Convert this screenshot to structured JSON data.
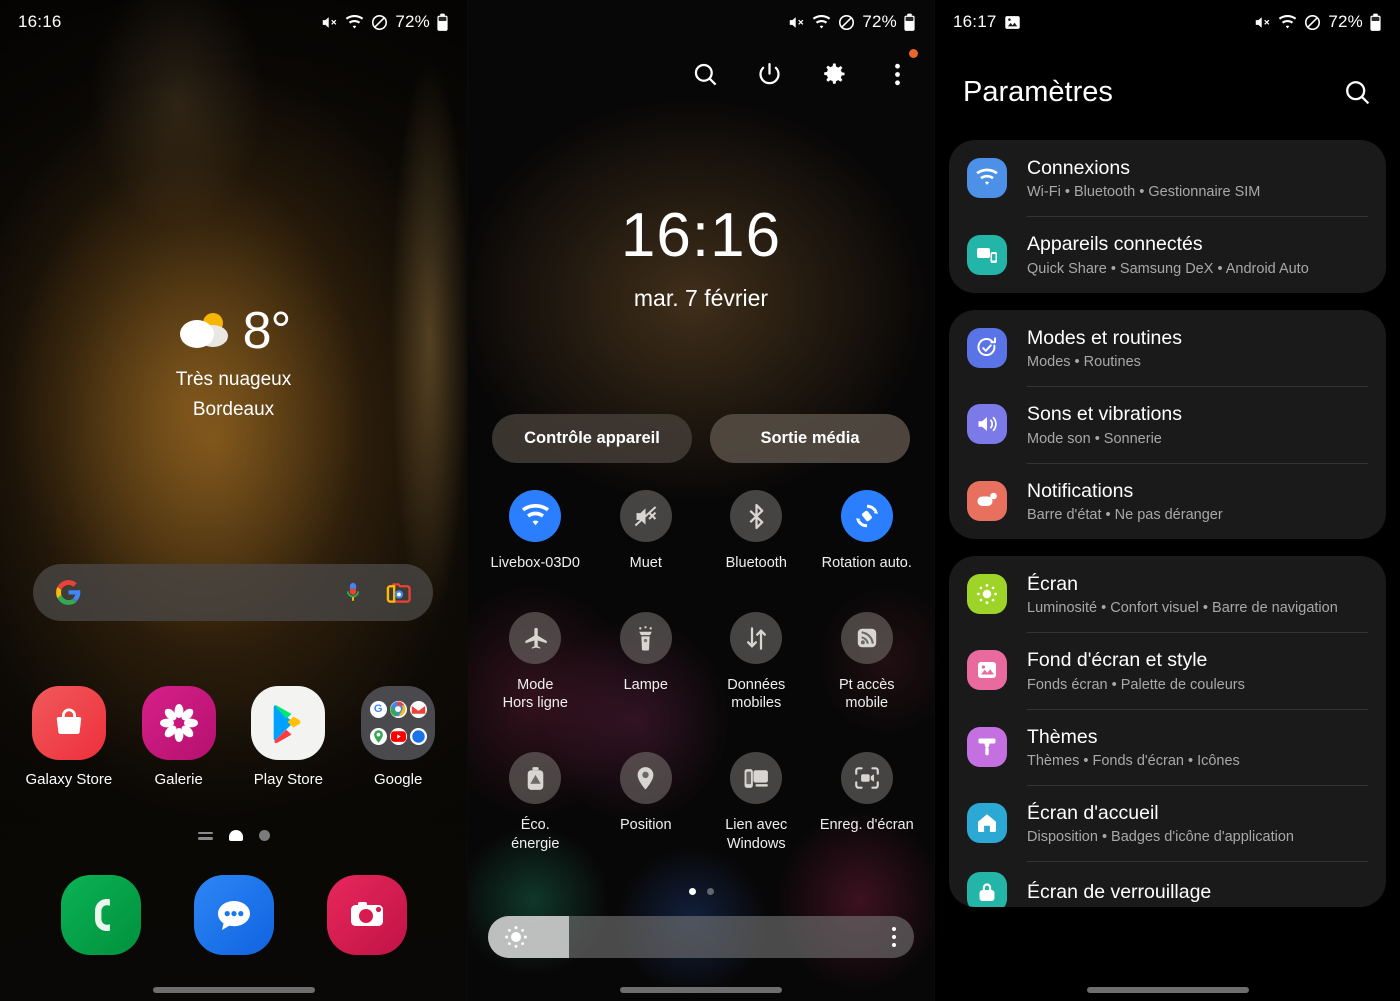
{
  "home": {
    "statusbar": {
      "time": "16:16",
      "battery_pct": "72%",
      "icons": [
        "mute-icon",
        "wifi-icon",
        "do-not-disturb-icon",
        "battery-icon"
      ]
    },
    "weather": {
      "icon": "partly-cloudy-icon",
      "temperature": "8°",
      "condition": "Très nuageux",
      "city": "Bordeaux"
    },
    "search": {
      "logo": "google-g-icon",
      "placeholder": "",
      "value": "",
      "mic_icon": "microphone-icon",
      "lens_icon": "google-lens-icon"
    },
    "apps": [
      {
        "label": "Galaxy Store",
        "icon": "galaxy-store-icon",
        "color": "#ee3a42"
      },
      {
        "label": "Galerie",
        "icon": "gallery-flower-icon",
        "color": "#c9177e"
      },
      {
        "label": "Play Store",
        "icon": "play-store-icon",
        "color": "#f2f2f2"
      },
      {
        "label": "Google",
        "icon": "google-folder-icon",
        "color": "#4a4a4e"
      }
    ],
    "page_indicators": [
      "app-list-icon",
      "home-page-active",
      "page-dot"
    ],
    "dock": [
      {
        "label": "Téléphone",
        "icon": "phone-icon",
        "color": "#00973f"
      },
      {
        "label": "Messages",
        "icon": "messages-icon",
        "color": "#1977f2"
      },
      {
        "label": "Appareil photo",
        "icon": "camera-icon",
        "color": "#d81b4e"
      }
    ]
  },
  "quickpanel": {
    "statusbar": {
      "time": "",
      "battery_pct": "72%"
    },
    "toolbar": [
      {
        "name": "search-icon",
        "label": "Rechercher"
      },
      {
        "name": "power-icon",
        "label": "Marche/Arrêt"
      },
      {
        "name": "gear-icon",
        "label": "Paramètres"
      },
      {
        "name": "more-icon",
        "label": "Plus"
      }
    ],
    "clock": {
      "time": "16:16",
      "date": "mar. 7 février"
    },
    "pills": [
      {
        "label": "Contrôle appareil"
      },
      {
        "label": "Sortie média"
      }
    ],
    "tiles": [
      {
        "label": "Livebox-03D0",
        "icon": "wifi-icon",
        "state": "on"
      },
      {
        "label": "Muet",
        "icon": "mute-icon",
        "state": "off"
      },
      {
        "label": "Bluetooth",
        "icon": "bluetooth-icon",
        "state": "off"
      },
      {
        "label": "Rotation auto.",
        "icon": "auto-rotate-icon",
        "state": "on"
      },
      {
        "label": "Mode\nHors ligne",
        "icon": "airplane-icon",
        "state": "off"
      },
      {
        "label": "Lampe",
        "icon": "flashlight-icon",
        "state": "off"
      },
      {
        "label": "Données\nmobiles",
        "icon": "mobile-data-icon",
        "state": "off"
      },
      {
        "label": "Pt accès\nmobile",
        "icon": "hotspot-icon",
        "state": "off"
      },
      {
        "label": "Éco.\nénergie",
        "icon": "power-saving-icon",
        "state": "off"
      },
      {
        "label": "Position",
        "icon": "location-pin-icon",
        "state": "off"
      },
      {
        "label": "Lien avec\nWindows",
        "icon": "link-to-windows-icon",
        "state": "off"
      },
      {
        "label": "Enreg. d'écran",
        "icon": "screen-record-icon",
        "state": "off"
      }
    ],
    "tile_labels": {
      "t0": "Livebox-03D0",
      "t1": "Muet",
      "t2": "Bluetooth",
      "t3": "Rotation auto.",
      "t4a": "Mode",
      "t4b": "Hors ligne",
      "t5": "Lampe",
      "t6a": "Données",
      "t6b": "mobiles",
      "t7a": "Pt accès",
      "t7b": "mobile",
      "t8a": "Éco.",
      "t8b": "énergie",
      "t9": "Position",
      "t10a": "Lien avec",
      "t10b": "Windows",
      "t11": "Enreg. d'écran"
    },
    "pages": {
      "current": 1,
      "total": 2
    },
    "brightness": {
      "value_pct": "19",
      "menu_icon": "more-vertical-icon",
      "sun_icon": "brightness-icon"
    }
  },
  "settings": {
    "statusbar": {
      "time": "16:17",
      "battery_pct": "72%",
      "extra_icon": "screenshot-icon"
    },
    "header": {
      "title": "Paramètres",
      "search_icon": "search-icon"
    },
    "groups": [
      {
        "items": [
          {
            "name": "Connexions",
            "sub": "Wi-Fi • Bluetooth • Gestionnaire SIM",
            "icon": "connections-wifi-icon",
            "color": "#4d90e8"
          },
          {
            "name": "Appareils connectés",
            "sub": "Quick Share • Samsung DeX • Android Auto",
            "icon": "connected-devices-icon",
            "color": "#23b5a8"
          }
        ]
      },
      {
        "items": [
          {
            "name": "Modes et routines",
            "sub": "Modes • Routines",
            "icon": "modes-routines-icon",
            "color": "#5a74e8"
          },
          {
            "name": "Sons et vibrations",
            "sub": "Mode son • Sonnerie",
            "icon": "sound-icon",
            "color": "#7b7ae8"
          },
          {
            "name": "Notifications",
            "sub": "Barre d'état • Ne pas déranger",
            "icon": "notifications-icon",
            "color": "#e8705f"
          }
        ]
      },
      {
        "items": [
          {
            "name": "Écran",
            "sub": "Luminosité • Confort visuel • Barre de navigation",
            "icon": "display-icon",
            "color": "#9ed428"
          },
          {
            "name": "Fond d'écran et style",
            "sub": "Fonds écran • Palette de couleurs",
            "icon": "wallpaper-icon",
            "color": "#e86a9e"
          },
          {
            "name": "Thèmes",
            "sub": "Thèmes • Fonds d'écran • Icônes",
            "icon": "themes-icon",
            "color": "#c470e0"
          },
          {
            "name": "Écran d'accueil",
            "sub": "Disposition • Badges d'icône d'application",
            "icon": "home-screen-icon",
            "color": "#2ba8d4"
          },
          {
            "name": "Écran de verrouillage",
            "sub": "",
            "icon": "lock-screen-icon",
            "color": "#23b5a8"
          }
        ]
      }
    ]
  }
}
